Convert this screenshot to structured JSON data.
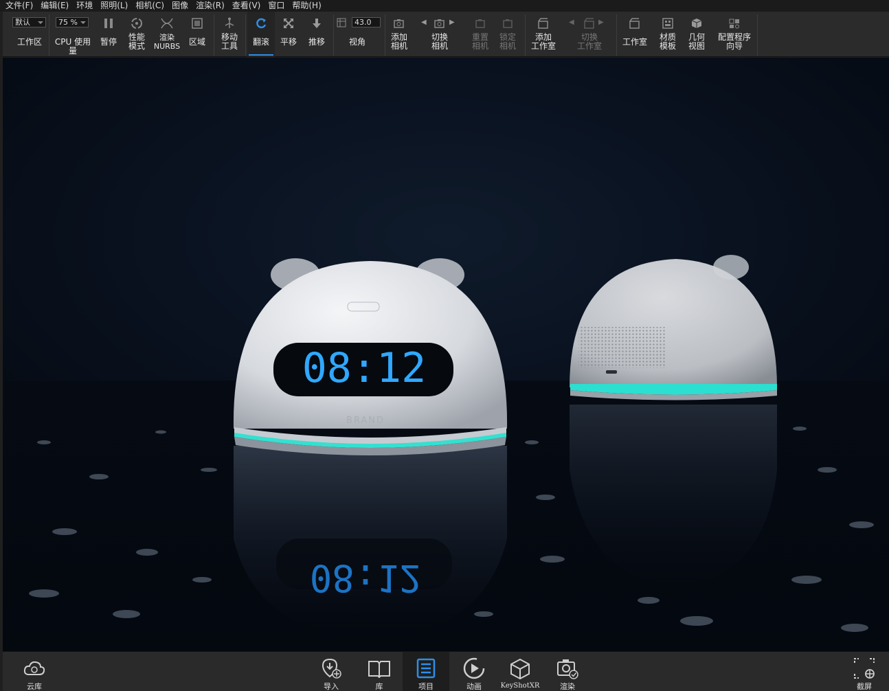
{
  "menu": [
    "文件(F)",
    "编辑(E)",
    "环境",
    "照明(L)",
    "相机(C)",
    "图像",
    "渲染(R)",
    "查看(V)",
    "窗口",
    "帮助(H)"
  ],
  "toolbar": {
    "workspace_value": "默认",
    "workspace_label": "工作区",
    "cpu_value": "75 %",
    "cpu_label": "CPU 使用量",
    "pause": "暂停",
    "performance": "性能\n模式",
    "nurbs": "渲染\nNURBS",
    "region": "区域",
    "move_tool": "移动\n工具",
    "tumble": "翻滚",
    "pan": "平移",
    "dolly": "推移",
    "fov_value": "43.0",
    "fov_label": "视角",
    "add_camera": "添加\n相机",
    "switch_camera": "切换\n相机",
    "reset_camera": "重置\n相机",
    "lock_camera": "锁定\n相机",
    "add_studio": "添加\n工作室",
    "switch_studio": "切换\n工作室",
    "studio": "工作室",
    "material_templates": "材质\n模板",
    "geometry_view": "几何\n视图",
    "config_wizard": "配置程序\n向导"
  },
  "viewport": {
    "clock_time": "08:12",
    "clock_reflection": "08:12",
    "brand_text": "BRAND",
    "colors": {
      "led": "#2fa8ff",
      "ring": "#35e0d0",
      "body": "#e4e6ea"
    }
  },
  "bottom": {
    "cloud_library": "云库",
    "import": "导入",
    "library": "库",
    "project": "项目",
    "animation": "动画",
    "keyshotxr": "KeyShotXR",
    "render": "渲染",
    "screenshot": "截屏"
  }
}
